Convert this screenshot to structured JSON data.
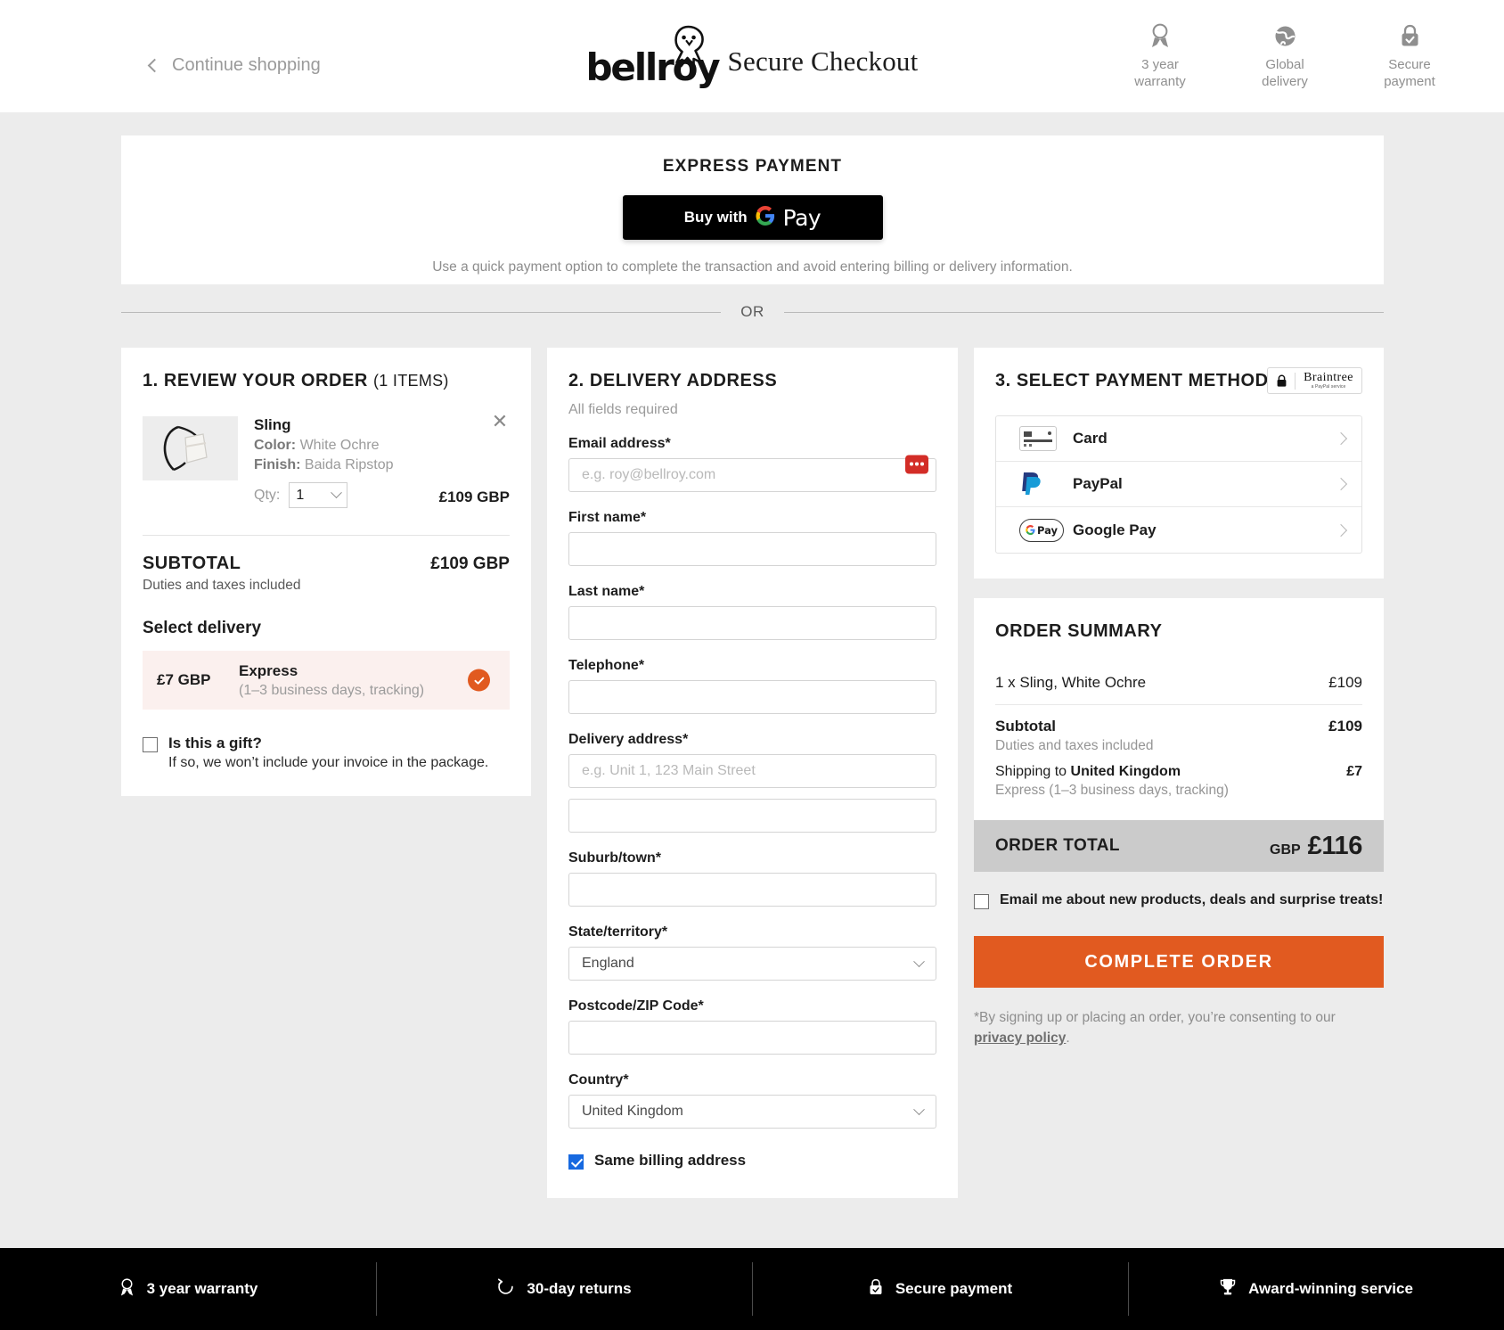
{
  "header": {
    "continue_shopping": "Continue shopping",
    "back_icon": "chevron-left-icon",
    "logo_text": "bellroy",
    "logo_icon": "owl-logo-icon",
    "title": "Secure Checkout",
    "badges": [
      {
        "icon": "award-ribbon-icon",
        "line1": "3 year",
        "line2": "warranty"
      },
      {
        "icon": "globe-icon",
        "line1": "Global",
        "line2": "delivery"
      },
      {
        "icon": "lock-check-icon",
        "line1": "Secure",
        "line2": "payment"
      }
    ]
  },
  "express": {
    "title": "EXPRESS PAYMENT",
    "gpay_buy_with": "Buy with",
    "gpay_pay": "Pay",
    "gpay_g": "G",
    "note": "Use a quick payment option to complete the transaction and avoid entering billing or delivery information."
  },
  "divider": {
    "label": "OR"
  },
  "order": {
    "heading": "1. REVIEW YOUR ORDER",
    "count": "(1 ITEMS)",
    "remove_icon": "close-icon",
    "product": {
      "name": "Sling",
      "color_label": "Color:",
      "color_value": "White Ochre",
      "finish_label": "Finish:",
      "finish_value": "Baida Ripstop",
      "qty_label": "Qty:",
      "qty_value": "1",
      "price": "£109 GBP",
      "image_alt": "sling-bag-white-ochre"
    },
    "subtotal_label": "SUBTOTAL",
    "subtotal_value": "£109 GBP",
    "subtotal_note": "Duties and taxes included",
    "select_delivery": "Select delivery",
    "shipping_option": {
      "price": "£7 GBP",
      "name": "Express",
      "description": "(1–3 business days, tracking)",
      "selected": true,
      "check_icon": "check-circle-icon"
    },
    "gift": {
      "checked": false,
      "label": "Is this a gift?",
      "sublabel": "If so, we won’t include your invoice in the package."
    }
  },
  "address": {
    "heading": "2. DELIVERY ADDRESS",
    "all_required": "All fields required",
    "fields": [
      {
        "label": "Email address*",
        "placeholder": "e.g. roy@bellroy.com",
        "value": "",
        "type": "input",
        "name": "email-field",
        "badge": "lastpass-icon"
      },
      {
        "label": "First name*",
        "placeholder": "",
        "value": "",
        "type": "input",
        "name": "first-name-field"
      },
      {
        "label": "Last name*",
        "placeholder": "",
        "value": "",
        "type": "input",
        "name": "last-name-field"
      },
      {
        "label": "Telephone*",
        "placeholder": "",
        "value": "",
        "type": "input",
        "name": "telephone-field"
      },
      {
        "label": "Delivery address*",
        "placeholder": "e.g. Unit 1, 123 Main Street",
        "value": "",
        "type": "input",
        "name": "delivery-address-field"
      },
      {
        "label": "",
        "placeholder": "",
        "value": "",
        "type": "input",
        "name": "delivery-address-line2-field"
      },
      {
        "label": "Suburb/town*",
        "placeholder": "",
        "value": "",
        "type": "input",
        "name": "suburb-town-field"
      },
      {
        "label": "State/territory*",
        "placeholder": "",
        "value": "England",
        "type": "select",
        "name": "state-territory-select"
      },
      {
        "label": "Postcode/ZIP Code*",
        "placeholder": "",
        "value": "",
        "type": "input",
        "name": "postcode-field"
      },
      {
        "label": "Country*",
        "placeholder": "",
        "value": "United Kingdom",
        "type": "select",
        "name": "country-select"
      }
    ],
    "same_billing": {
      "checked": true,
      "label": "Same billing address"
    }
  },
  "payment": {
    "heading": "3. SELECT PAYMENT METHOD",
    "braintree": {
      "main": "Braintree",
      "sub": "a PayPal service",
      "lock_icon": "lock-icon"
    },
    "methods": [
      {
        "label": "Card",
        "icon": "credit-card-icon"
      },
      {
        "label": "PayPal",
        "icon": "paypal-icon"
      },
      {
        "label": "Google Pay",
        "icon": "google-pay-icon"
      }
    ]
  },
  "summary": {
    "title": "ORDER SUMMARY",
    "item_label": "1 x Sling, White Ochre",
    "item_value": "£109",
    "subtotal_label": "Subtotal",
    "subtotal_value": "£109",
    "subtotal_note": "Duties and taxes included",
    "shipping_prefix": "Shipping to ",
    "shipping_country": "United Kingdom",
    "shipping_value": "£7",
    "shipping_note": "Express (1–3 business days, tracking)",
    "total_label": "ORDER TOTAL",
    "total_currency": "GBP",
    "total_amount": "£116",
    "email_optin": {
      "checked": false,
      "label": "Email me about new products, deals and surprise treats!"
    },
    "complete_button": "COMPLETE ORDER",
    "consent_text": "*By signing up or placing an order, you’re consenting to our ",
    "consent_link": "privacy policy",
    "consent_tail": "."
  },
  "footer": [
    {
      "icon": "award-ribbon-icon",
      "label": "3 year warranty"
    },
    {
      "icon": "returns-arrow-icon",
      "label": "30-day returns"
    },
    {
      "icon": "lock-check-icon",
      "label": "Secure payment"
    },
    {
      "icon": "trophy-icon",
      "label": "Award-winning service"
    }
  ],
  "colors": {
    "accent_orange": "#e15a20",
    "shipping_highlight": "#fbf0ee",
    "total_bar": "#cbcbcb",
    "page_bg": "#ececec",
    "footer_bg": "#000000"
  }
}
